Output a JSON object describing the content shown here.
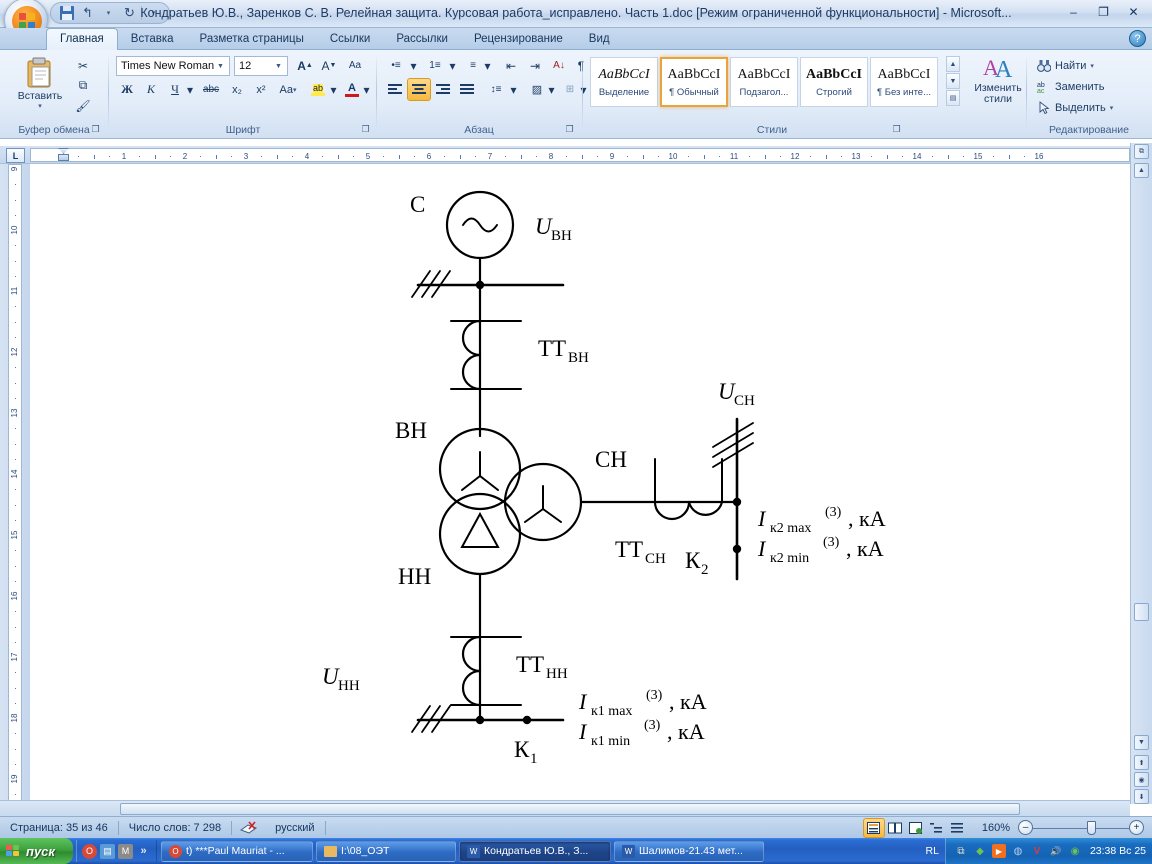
{
  "window": {
    "title": "Кондратьев Ю.В., Заренков С. В. Релейная защита. Курсовая работа_исправлено. Часть 1.doc [Режим ограниченной функциональности] - Microsoft...",
    "minimize": "–",
    "restore": "❐",
    "close": "✕",
    "help": "?"
  },
  "quick_access": {
    "save": "save-icon",
    "undo": "↰",
    "redo": "↻",
    "customize": "▾"
  },
  "tabs": [
    {
      "label": "Главная",
      "active": true
    },
    {
      "label": "Вставка",
      "active": false
    },
    {
      "label": "Разметка страницы",
      "active": false
    },
    {
      "label": "Ссылки",
      "active": false
    },
    {
      "label": "Рассылки",
      "active": false
    },
    {
      "label": "Рецензирование",
      "active": false
    },
    {
      "label": "Вид",
      "active": false
    }
  ],
  "ribbon": {
    "clipboard": {
      "label": "Буфер обмена",
      "paste_label": "Вставить",
      "paste_arrow": "▾",
      "cut": "✂",
      "copy": "⧉",
      "format_painter": "🖌",
      "dialog_launcher": "❐"
    },
    "font": {
      "label": "Шрифт",
      "family_value": "Times New Roman",
      "size_value": "12",
      "grow": "A",
      "shrink": "A",
      "clear_format": "Aa",
      "bold": "Ж",
      "italic": "К",
      "underline": "Ч",
      "underline_arrow": "▾",
      "strikethrough": "abc",
      "subscript": "x₂",
      "superscript": "x²",
      "change_case": "Aa",
      "highlight": "ab",
      "font_color": "A",
      "dialog_launcher": "❐"
    },
    "paragraph": {
      "label": "Абзац",
      "bullets": "•≡",
      "numbering": "1≡",
      "multilevel": "≡",
      "decrease_indent": "⇤",
      "increase_indent": "⇥",
      "sort": "A↓",
      "show_marks": "¶",
      "align_left": "≡",
      "align_center": "≡",
      "align_right": "≡",
      "justify": "≡",
      "line_spacing": "↕≡",
      "shading": "▨",
      "borders": "⊞",
      "dialog_launcher": "❐"
    },
    "styles": {
      "label": "Стили",
      "items": [
        {
          "preview": "AaBbCcI",
          "name": "Выделение",
          "selected": false,
          "italic": true,
          "bold": false
        },
        {
          "preview": "AaBbCcI",
          "name": "¶ Обычный",
          "selected": true,
          "italic": false,
          "bold": false
        },
        {
          "preview": "AaBbCcI",
          "name": "Подзагол...",
          "selected": false,
          "italic": false,
          "bold": false
        },
        {
          "preview": "AaBbCcI",
          "name": "Строгий",
          "selected": false,
          "italic": false,
          "bold": true
        },
        {
          "preview": "AaBbCcI",
          "name": "¶ Без инте...",
          "selected": false,
          "italic": false,
          "bold": false
        }
      ],
      "change_styles_label": "Изменить",
      "change_styles_label2": "стили",
      "change_styles_arrow": "▾",
      "dialog_launcher": "❐",
      "nav_up": "▲",
      "nav_down": "▼",
      "nav_more": "▤"
    },
    "editing": {
      "label": "Редактирование",
      "find": "Найти",
      "find_arrow": "▾",
      "replace": "Заменить",
      "select": "Выделить",
      "select_arrow": "▾"
    }
  },
  "ruler": {
    "horizontal_marks": [
      "1",
      "2",
      "3",
      "4",
      "5",
      "6",
      "7",
      "8",
      "9",
      "10",
      "11",
      "12",
      "13",
      "14",
      "15",
      "16"
    ],
    "vertical_marks": [
      "9",
      "10",
      "11",
      "12",
      "13",
      "14",
      "15",
      "16",
      "17",
      "18",
      "19"
    ],
    "corner_tab": "L"
  },
  "diagram": {
    "title": "Схема релейной защиты трансформатора",
    "labels": {
      "source": "С",
      "u_vn": "U",
      "u_vn_sub": "ВН",
      "tt_vn": "ТТ",
      "tt_vn_sub": "ВН",
      "vn": "ВН",
      "sn": "СН",
      "nn": "НН",
      "u_sn": "U",
      "u_sn_sub": "СН",
      "tt_sn": "ТТ",
      "tt_sn_sub": "СН",
      "k2": "К",
      "k2_sub": "2",
      "i_k2_max": "I",
      "i_k2_max_sub": "к2 max",
      "i_k2_max_sup": "(3)",
      "i_k2_max_unit": ", кА",
      "i_k2_min": "I",
      "i_k2_min_sub": "к2 min",
      "i_k2_min_sup": "(3)",
      "i_k2_min_unit": ", кА",
      "u_nn": "U",
      "u_nn_sub": "НН",
      "tt_nn": "ТТ",
      "tt_nn_sub": "НН",
      "k1": "К",
      "k1_sub": "1",
      "i_k1_max": "I",
      "i_k1_max_sub": "к1 max",
      "i_k1_max_sup": "(3)",
      "i_k1_max_unit": ", кА",
      "i_k1_min": "I",
      "i_k1_min_sub": "к1 min",
      "i_k1_min_sup": "(3)",
      "i_k1_min_unit": ", кА"
    }
  },
  "status": {
    "page": "Страница: 35 из 46",
    "words": "Число слов: 7 298",
    "proofing_icon": "proofing-errors-icon",
    "language": "русский",
    "zoom_value": "160%",
    "zoom_out": "–",
    "zoom_in": "+",
    "views": [
      {
        "name": "print-layout",
        "glyph": "▤",
        "active": true
      },
      {
        "name": "full-screen-reading",
        "glyph": "▥",
        "active": false
      },
      {
        "name": "web-layout",
        "glyph": "▦",
        "active": false
      },
      {
        "name": "outline",
        "glyph": "▧",
        "active": false
      },
      {
        "name": "draft",
        "glyph": "▨",
        "active": false
      }
    ]
  },
  "taskbar": {
    "start_label": "пуск",
    "quick_launch": [
      {
        "name": "opera-icon",
        "glyph": "O",
        "color": "#d84a38"
      },
      {
        "name": "calculator-icon",
        "glyph": "▤",
        "color": "#5b9bd5"
      },
      {
        "name": "winamp-icon",
        "glyph": "M",
        "color": "#7a7a7a"
      },
      {
        "name": "more-chevron-icon",
        "glyph": "»",
        "color": "transparent"
      }
    ],
    "tasks": [
      {
        "icon": "opera-icon",
        "label": "t) ***Paul Mauriat - ...",
        "active": false
      },
      {
        "icon": "folder-icon",
        "label": "I:\\08_ОЭТ",
        "active": false
      },
      {
        "icon": "word-icon",
        "label": "Кондратьев Ю.В., З...",
        "active": true
      },
      {
        "icon": "word-icon",
        "label": "Шалимов-21.43 мет...",
        "active": false
      }
    ],
    "language": "RL",
    "tray_icons": [
      {
        "name": "copy-tray-icon",
        "glyph": "⧉",
        "color": "#d9d4b0"
      },
      {
        "name": "network-tray-icon",
        "glyph": "◆",
        "color": "#6ec24f"
      },
      {
        "name": "media-player-tray-icon",
        "glyph": "▶",
        "color": "#f07020"
      },
      {
        "name": "volume-control-tray-icon",
        "glyph": "◍",
        "color": "#9fb0c4"
      },
      {
        "name": "antivirus-tray-icon",
        "glyph": "V",
        "color": "#e03a3a"
      },
      {
        "name": "volume-tray-icon",
        "glyph": "🔊",
        "color": "#e03a3a"
      },
      {
        "name": "nvidia-tray-icon",
        "glyph": "◉",
        "color": "#6ec24f"
      }
    ],
    "clock": "23:38 Вс 25"
  }
}
